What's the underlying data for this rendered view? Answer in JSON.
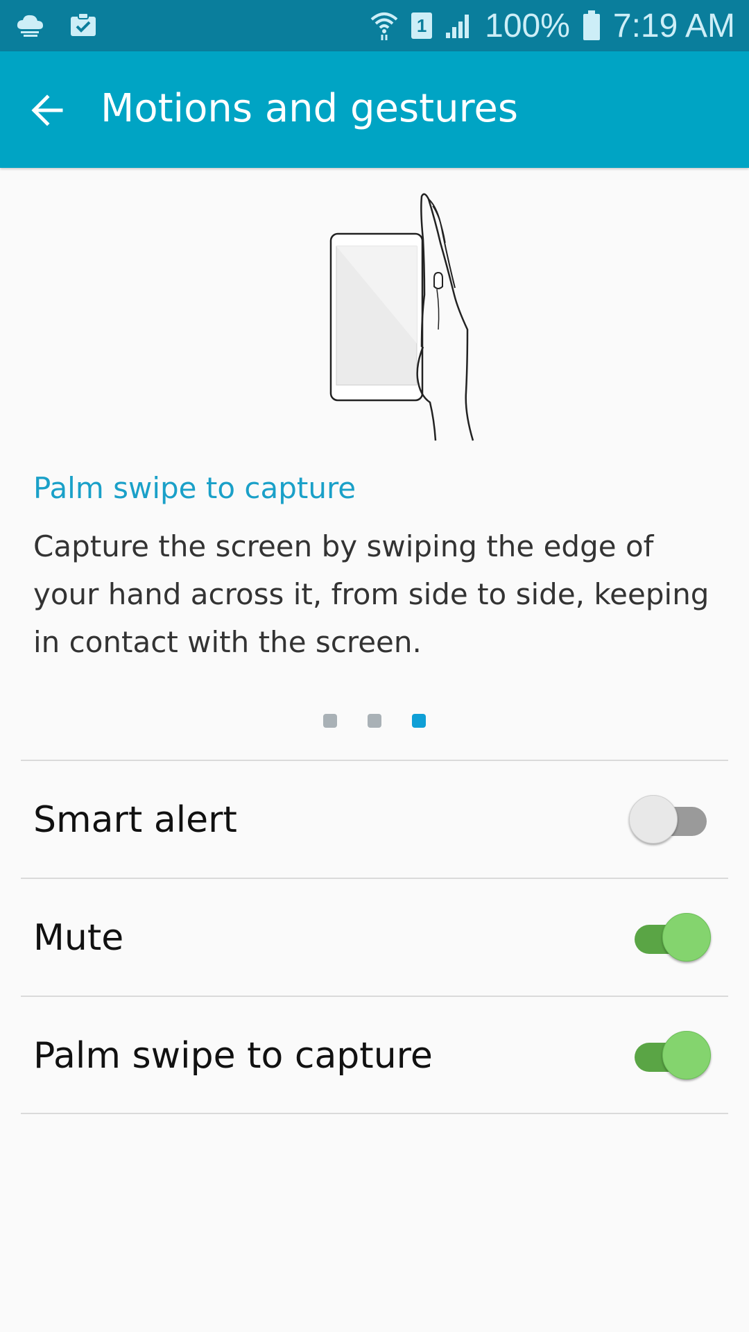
{
  "status_bar": {
    "battery": "100%",
    "time": "7:19 AM",
    "sim_slot": "1",
    "icons": [
      "cloud-icon",
      "clipboard-check-icon",
      "wifi-icon",
      "sim-icon",
      "signal-icon",
      "battery-icon"
    ]
  },
  "header": {
    "title": "Motions and gestures",
    "back_icon": "back-arrow-icon"
  },
  "feature_card": {
    "title": "Palm swipe to capture",
    "description": "Capture the screen by swiping the edge of your hand across it, from side to side, keeping in contact with the screen.",
    "page_count": 3,
    "active_page": 3
  },
  "settings": [
    {
      "label": "Smart alert",
      "enabled": false
    },
    {
      "label": "Mute",
      "enabled": true
    },
    {
      "label": "Palm swipe to capture",
      "enabled": true
    }
  ],
  "colors": {
    "status_bar": "#0a7e9c",
    "app_bar": "#00a4c4",
    "accent_title": "#1aa0c8",
    "switch_on_track": "#5aa545",
    "switch_on_thumb": "#84d46e",
    "switch_off_track": "#9a9a9a",
    "switch_off_thumb": "#e8e8e8",
    "dot_active": "#0f9fd6",
    "dot_inactive": "#a9b1b6"
  }
}
